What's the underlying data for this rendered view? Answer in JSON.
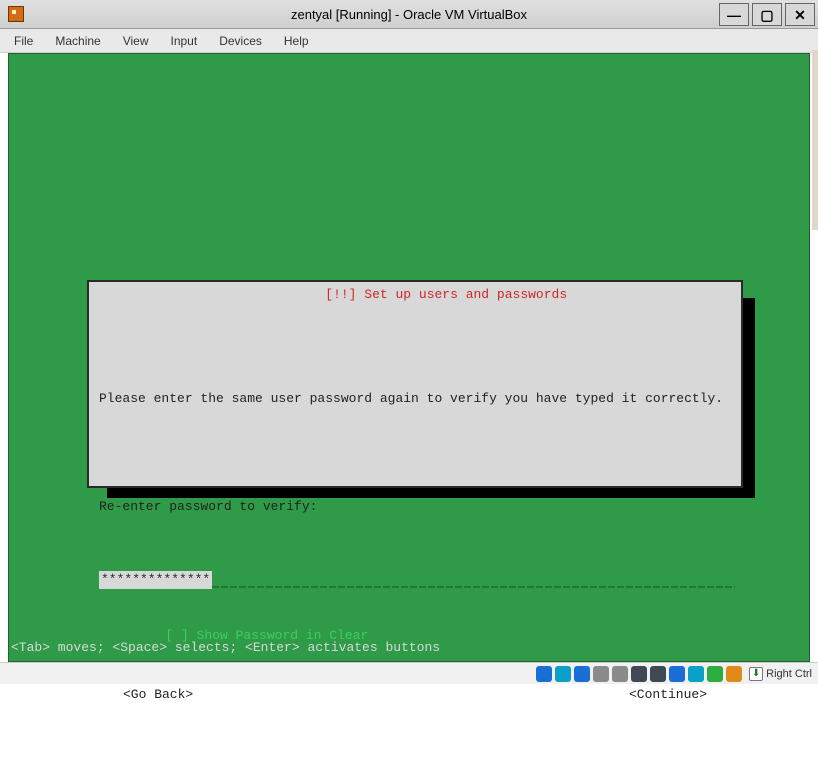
{
  "window": {
    "title": "zentyal [Running] - Oracle VM VirtualBox",
    "buttons": {
      "minimize": "—",
      "maximize": "▢",
      "close": "✕"
    }
  },
  "menubar": [
    "File",
    "Machine",
    "View",
    "Input",
    "Devices",
    "Help"
  ],
  "dialog": {
    "title": "[!!] Set up users and passwords",
    "message": "Please enter the same user password again to verify you have typed it correctly.",
    "prompt": "Re-enter password to verify:",
    "password_mask": "**************",
    "checkbox": "[ ] Show Password in Clear",
    "go_back": "<Go Back>",
    "continue": "<Continue>"
  },
  "hint": "<Tab> moves; <Space> selects; <Enter> activates buttons",
  "statusbar": {
    "host_key": "Right Ctrl"
  }
}
